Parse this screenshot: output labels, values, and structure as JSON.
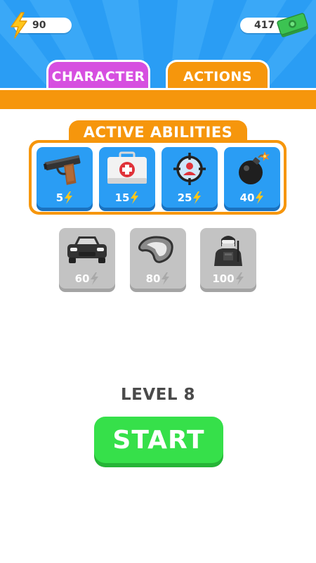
{
  "top_bar": {
    "energy_value": "90",
    "cash_value": "417",
    "energy_icon": "lightning-bolt-icon",
    "cash_icon": "cash-stack-icon"
  },
  "tabs": [
    {
      "label": "CHARACTER",
      "color": "#d64fe0",
      "selected": false
    },
    {
      "label": "ACTIONS",
      "color": "#f6960c",
      "selected": true
    }
  ],
  "abilities": {
    "title": "ACTIVE ABILITIES",
    "unlocked": [
      {
        "icon": "pistol-icon",
        "cost": "5"
      },
      {
        "icon": "first-aid-kit-icon",
        "cost": "15"
      },
      {
        "icon": "crosshair-target-icon",
        "cost": "25"
      },
      {
        "icon": "bomb-icon",
        "cost": "40"
      }
    ],
    "locked": [
      {
        "icon": "car-icon",
        "cost": "60"
      },
      {
        "icon": "steak-icon",
        "cost": "80"
      },
      {
        "icon": "soldier-icon",
        "cost": "100"
      }
    ]
  },
  "level_label": "LEVEL 8",
  "start_label": "START",
  "colors": {
    "sky_blue": "#2a9df4",
    "orange": "#f6960c",
    "purple": "#d64fe0",
    "green": "#36e04a",
    "bolt_yellow": "#ffc61a",
    "locked_grey": "#c3c3c3"
  }
}
